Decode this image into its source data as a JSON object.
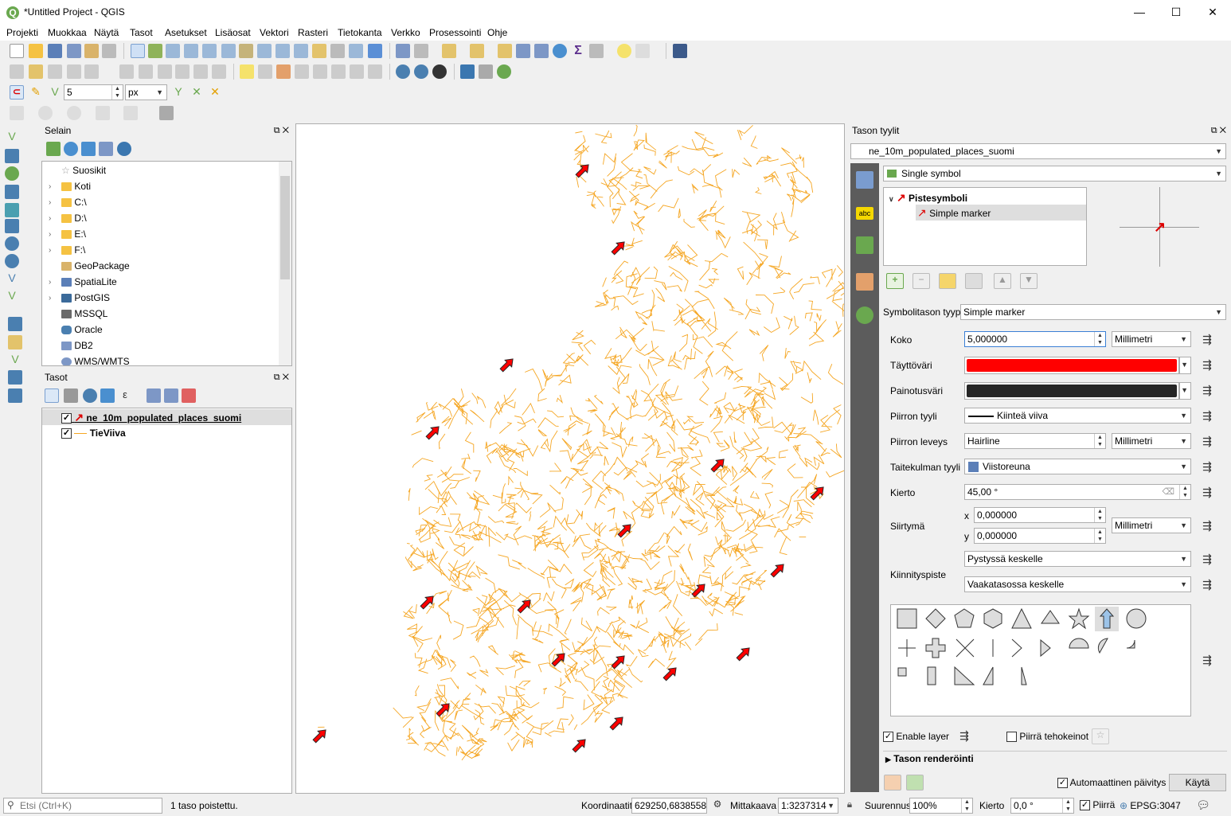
{
  "window": {
    "title": "*Untitled Project - QGIS",
    "min_glyph": "—",
    "max_glyph": "☐",
    "close_glyph": "✕"
  },
  "menus": [
    "Projekti",
    "Muokkaa",
    "Näytä",
    "Tasot",
    "Asetukset",
    "Lisäosat",
    "Vektori",
    "Rasteri",
    "Tietokanta",
    "Verkko",
    "Prosessointi",
    "Ohje"
  ],
  "snapping": {
    "tolerance": "5",
    "unit": "px"
  },
  "browser": {
    "title": "Selain",
    "items": [
      "Suosikit",
      "Koti",
      "C:\\",
      "D:\\",
      "E:\\",
      "F:\\",
      "GeoPackage",
      "SpatiaLite",
      "PostGIS",
      "MSSQL",
      "Oracle",
      "DB2",
      "WMS/WMTS"
    ]
  },
  "layers": {
    "title": "Tasot",
    "items": [
      {
        "name": "ne_10m_populated_places_suomi",
        "checked": true
      },
      {
        "name": "TieViiva",
        "checked": true
      }
    ]
  },
  "style_panel": {
    "title": "Tason tyylit",
    "layer": "ne_10m_populated_places_suomi",
    "renderer": "Single symbol",
    "symbol_tree": {
      "root": "Pistesymboli",
      "child": "Simple marker"
    },
    "symbol_layer_type_label": "Symbolitason tyyppi",
    "symbol_layer_type": "Simple marker",
    "size_label": "Koko",
    "size": "5,000000",
    "size_unit": "Millimetri",
    "fill_label": "Täyttöväri",
    "fill_color": "#ff0000",
    "stroke_color_label": "Painotusväri",
    "stroke_color": "#262626",
    "stroke_style_label": "Piirron tyyli",
    "stroke_style": "Kiinteä viiva",
    "stroke_width_label": "Piirron leveys",
    "stroke_width": "Hairline",
    "stroke_width_unit": "Millimetri",
    "join_label": "Taitekulman tyyli",
    "join": "Viistoreuna",
    "rotation_label": "Kierto",
    "rotation": "45,00 °",
    "offset_label": "Siirtymä",
    "offset_x_label": "x",
    "offset_x": "0,000000",
    "offset_y_label": "y",
    "offset_y": "0,000000",
    "offset_unit": "Millimetri",
    "anchor_label": "Kiinnityspiste",
    "anchor_v": "Pystyssä keskelle",
    "anchor_h": "Vaakatasossa keskelle",
    "enable_layer": "Enable layer",
    "draw_effects": "Piirrä tehokeinot",
    "rendering_section": "Tason renderöinti",
    "auto_update": "Automaattinen päivitys",
    "apply": "Käytä",
    "tab_label_icon": "abc"
  },
  "status": {
    "search_placeholder": "Etsi (Ctrl+K)",
    "message": "1 taso poistettu.",
    "coord_label": "Koordinaatit",
    "coord": "629250,6838558",
    "scale_label": "Mittakaava",
    "scale": "1:3237314",
    "zoom_label": "Suurennus",
    "zoom": "100%",
    "rotation_label": "Kierto",
    "rotation": "0,0 °",
    "render_label": "Piirrä",
    "crs": "EPSG:3047"
  },
  "colors": {
    "road": "#f5a623",
    "marker_fill": "#ff0000",
    "marker_stroke": "#262626"
  }
}
